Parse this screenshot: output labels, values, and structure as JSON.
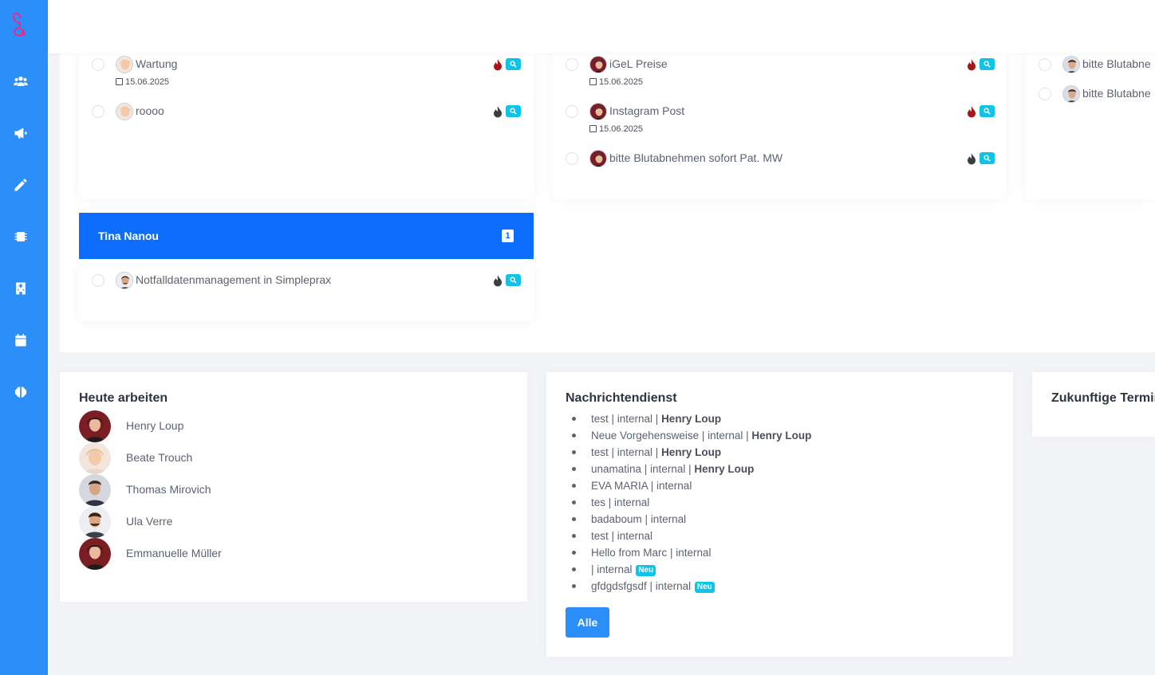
{
  "colors": {
    "sidebar": "#2c8ef8",
    "header_blue": "#0d6efd",
    "badge_cyan": "#0fc4e8",
    "flame_red": "#a4161a",
    "flame_dark": "#3d3d3d"
  },
  "sidebar": {
    "logo": "stethoscope-logo",
    "icons": [
      "users-icon",
      "megaphone-icon",
      "pencil-icon",
      "chip-icon",
      "hospital-icon",
      "calendar-icon",
      "brain-icon"
    ]
  },
  "columns": {
    "col1": {
      "tasks": [
        {
          "title": "Wartung",
          "date": "15.06.2025",
          "priority": "high"
        },
        {
          "title": "roooo",
          "date": "",
          "priority": "low"
        }
      ]
    },
    "col2": {
      "tasks": [
        {
          "title": "iGeL Preise",
          "date": "15.06.2025",
          "priority": "high"
        },
        {
          "title": "Instagram Post",
          "date": "15.06.2025",
          "priority": "high"
        },
        {
          "title": "bitte Blutabnehmen sofort Pat. MW",
          "date": "",
          "priority": "low"
        }
      ]
    },
    "col3": {
      "tasks": [
        {
          "title": "bitte Blutabne"
        },
        {
          "title": "bitte Blutabne"
        }
      ]
    },
    "group": {
      "name": "Tina Nanou",
      "count": "1",
      "tasks": [
        {
          "title": "Notfalldatenmanagement in Simpleprax",
          "priority": "low"
        }
      ]
    }
  },
  "today": {
    "title": "Heute arbeiten",
    "employees": [
      "Henry Loup",
      "Beate Trouch",
      "Thomas Mirovich",
      "Ula Verre",
      "Emmanuelle Müller"
    ]
  },
  "news": {
    "title": "Nachrichtendienst",
    "items": [
      {
        "text": "test | internal | ",
        "author": "Henry Loup",
        "new": ""
      },
      {
        "text": "Neue Vorgehensweise | internal | ",
        "author": "Henry Loup",
        "new": ""
      },
      {
        "text": "test | internal | ",
        "author": "Henry Loup",
        "new": ""
      },
      {
        "text": "unamatina | internal | ",
        "author": "Henry Loup",
        "new": ""
      },
      {
        "text": "EVA MARIA | internal",
        "author": "",
        "new": ""
      },
      {
        "text": "tes | internal",
        "author": "",
        "new": ""
      },
      {
        "text": "badaboum | internal",
        "author": "",
        "new": ""
      },
      {
        "text": "test | internal",
        "author": "",
        "new": ""
      },
      {
        "text": "Hello from Marc | internal",
        "author": "",
        "new": ""
      },
      {
        "text": "| internal",
        "author": "",
        "new": "Neu"
      },
      {
        "text": "gfdgdsfgsdf | internal",
        "author": "",
        "new": "Neu"
      }
    ],
    "button": "Alle"
  },
  "future": {
    "title": "Zukunftige Termin"
  }
}
